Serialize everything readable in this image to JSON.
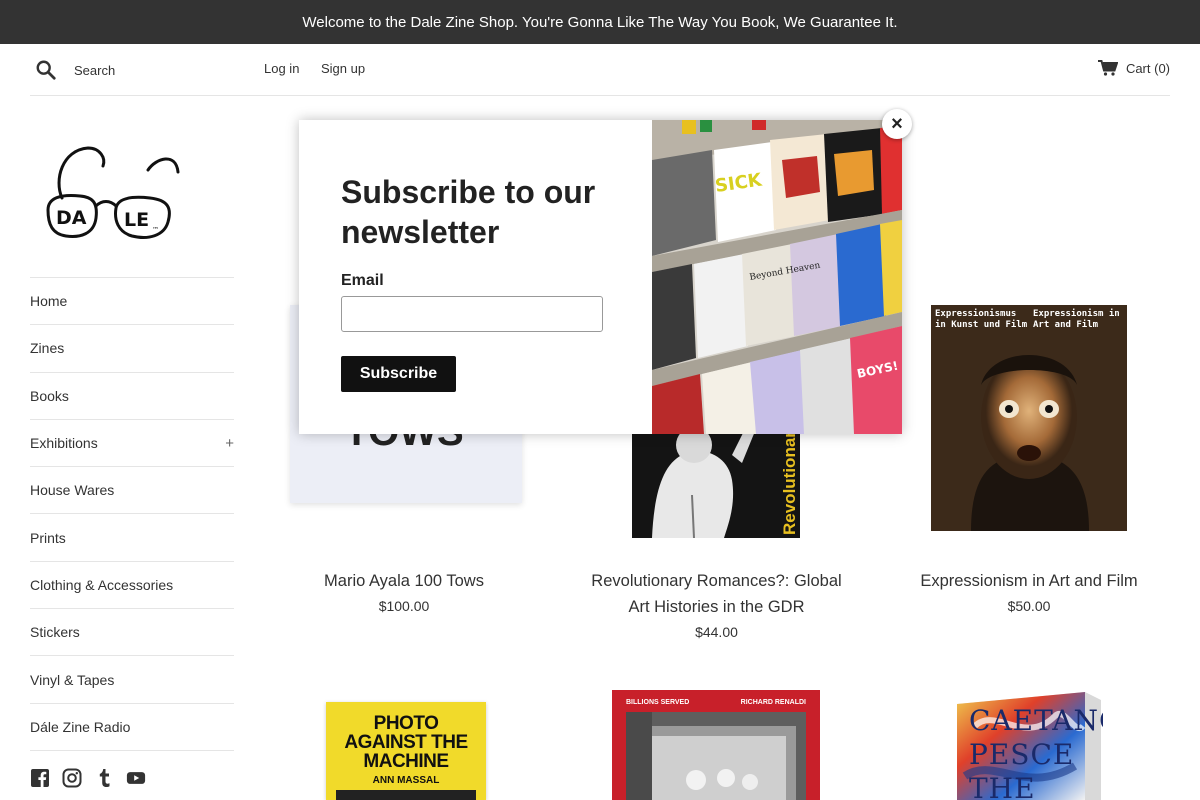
{
  "announcement": "Welcome to the Dale Zine Shop. You're Gonna Like The Way You Book, We Guarantee It.",
  "header": {
    "search_placeholder": "Search",
    "login": "Log in",
    "signup": "Sign up",
    "cart": "Cart (0)"
  },
  "nav": {
    "items": [
      {
        "label": "Home"
      },
      {
        "label": "Zines"
      },
      {
        "label": "Books"
      },
      {
        "label": "Exhibitions",
        "expand": "+"
      },
      {
        "label": "House Wares"
      },
      {
        "label": "Prints"
      },
      {
        "label": "Clothing & Accessories"
      },
      {
        "label": "Stickers"
      },
      {
        "label": "Vinyl & Tapes"
      },
      {
        "label": "Dále Zine Radio"
      }
    ]
  },
  "social": [
    "facebook-icon",
    "instagram-icon",
    "tumblr-icon",
    "youtube-icon"
  ],
  "products": [
    {
      "title": "Mario Ayala 100 Tows",
      "price": "$100.00",
      "cover_text": "TOWS"
    },
    {
      "title": "Revolutionary Romances?: Global Art Histories in the GDR",
      "price": "$44.00",
      "cover_text": "Revolutionary Romances?"
    },
    {
      "title": "Expressionism in Art and Film",
      "price": "$50.00",
      "cover_text_1": "Expressionismus in Kunst und Film",
      "cover_text_2": "Expressionism in Art and Film"
    },
    {
      "cover_text_1": "PHOTO AGAINST THE MACHINE",
      "cover_text_2": "ANN MASSAL"
    },
    {
      "cover_text_1": "BILLIONS SERVED",
      "cover_text_2": "RICHARD RENALDI"
    },
    {
      "cover_text": "CAETANO PESCE THE"
    }
  ],
  "modal": {
    "title": "Subscribe to our newsletter",
    "email_label": "Email",
    "email_value": "",
    "subscribe": "Subscribe",
    "close": "×"
  },
  "colors": {
    "announcement_bg": "#333333",
    "button_bg": "#111111",
    "text": "#333333"
  }
}
